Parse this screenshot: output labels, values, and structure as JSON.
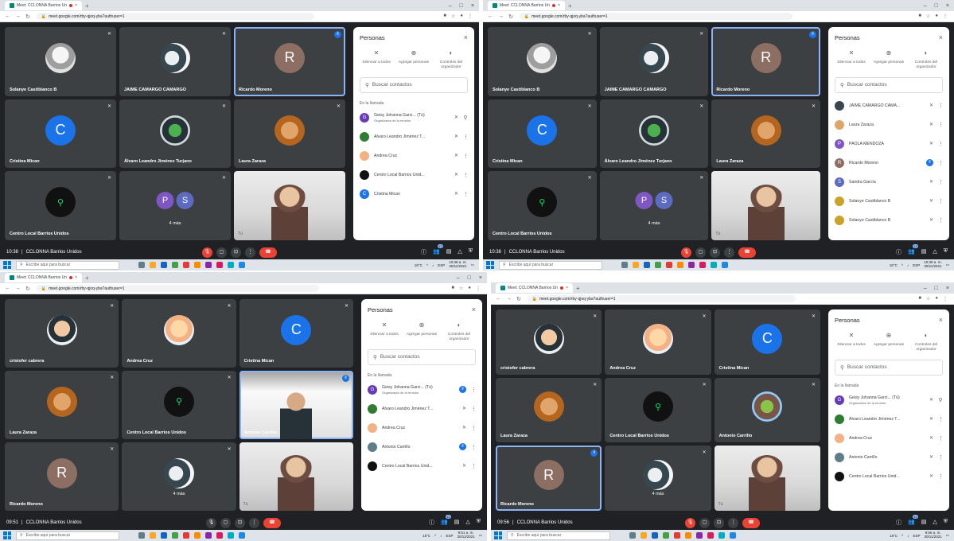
{
  "browser": {
    "tab_title": "Meet: CCLONNA Barrios Un",
    "new_tab": "+",
    "url": "meet.google.com/rby-qjoq-yba?authuser=1"
  },
  "meeting_name": "CCLONNA Barrios Unidos",
  "panel": {
    "title": "Personas",
    "actions": [
      {
        "label": "Silenciar a todos",
        "icon": "mute-all-icon"
      },
      {
        "label": "Agregar personas",
        "icon": "add-person-icon"
      },
      {
        "label": "Controles del organizador",
        "icon": "host-controls-icon"
      }
    ],
    "search_placeholder": "Buscar contactos",
    "section": "En la llamada",
    "organizer_sub": "Organizador de la reunión"
  },
  "taskbar": {
    "search_placeholder": "Escribe aquí para buscar",
    "weather": "18°C",
    "lang": "ESP",
    "date": "30/11/2021"
  },
  "quads": [
    {
      "time": "10:38",
      "clock": "10:38 a. m.",
      "badge": "12",
      "tiles": [
        {
          "name": "Solanye Castiblanco B",
          "avatar": "photo"
        },
        {
          "name": "JAIME CAMARGO CAMARGO",
          "avatar": "pair"
        },
        {
          "name": "Ricardo Moreno",
          "avatar": "R",
          "active": true
        },
        {
          "name": "Cristina Mican",
          "avatar": "C"
        },
        {
          "name": "Álvaro Leandro Jiménez Turjano",
          "avatar": "team"
        },
        {
          "name": "Laura Zaraza",
          "avatar": "cat"
        },
        {
          "name": "Centro Local Barrios Unidos",
          "avatar": "bike"
        },
        {
          "name": "4 más",
          "avatar": "ps"
        },
        {
          "name": "Tú",
          "avatar": "cam"
        }
      ],
      "people": [
        {
          "name": "Geisy Johanna Garci... (Tú)",
          "sub": true,
          "color": "#673ab7",
          "letter": "G",
          "right": "pin"
        },
        {
          "name": "Álvaro Leandro Jiménez T...",
          "color": "#2e7d32",
          "letter": "",
          "right": "dots"
        },
        {
          "name": "Andrea Cruz",
          "color": "#f4b183",
          "letter": "",
          "right": "dots"
        },
        {
          "name": "Centro Local Barrios Unid...",
          "color": "#111111",
          "letter": "",
          "right": "dots"
        },
        {
          "name": "Cristina Mican",
          "color": "#1a73e8",
          "letter": "C",
          "right": "dots"
        }
      ]
    },
    {
      "time": "10:38",
      "clock": "10:38 a. m.",
      "badge": "12",
      "tiles": [
        {
          "name": "Solanye Castiblanco B",
          "avatar": "photo"
        },
        {
          "name": "JAIME CAMARGO CAMARGO",
          "avatar": "pair"
        },
        {
          "name": "Ricardo Moreno",
          "avatar": "R",
          "active": true
        },
        {
          "name": "Cristina Mican",
          "avatar": "C"
        },
        {
          "name": "Álvaro Leandro Jiménez Turjano",
          "avatar": "team"
        },
        {
          "name": "Laura Zaraza",
          "avatar": "cat"
        },
        {
          "name": "Centro Local Barrios Unidos",
          "avatar": "bike"
        },
        {
          "name": "4 más",
          "avatar": "ps"
        },
        {
          "name": "Tú",
          "avatar": "cam"
        }
      ],
      "people": [
        {
          "name": "JAIME CAMARGO CAMA...",
          "color": "#37474f",
          "letter": "",
          "right": "dots"
        },
        {
          "name": "Laura Zaraza",
          "color": "#e0a56b",
          "letter": "",
          "right": "dots"
        },
        {
          "name": "PAOLA MENDOZA",
          "color": "#7e57c2",
          "letter": "P",
          "right": "dots"
        },
        {
          "name": "Ricardo Moreno",
          "color": "#8d6e63",
          "letter": "R",
          "right": "blue"
        },
        {
          "name": "Sandra García",
          "color": "#5c6bc0",
          "letter": "S",
          "right": "dots"
        },
        {
          "name": "Solanye Castiblanco B",
          "color": "#c9a227",
          "letter": "",
          "right": "dots"
        },
        {
          "name": "Solanye Castiblanco B",
          "color": "#c9a227",
          "letter": "",
          "right": "dots"
        }
      ]
    },
    {
      "time": "09:51",
      "clock": "9:51 a. m.",
      "badge": "12",
      "tiles": [
        {
          "name": "cristofer cabrera",
          "avatar": "boy"
        },
        {
          "name": "Andrea Cruz",
          "avatar": "girl"
        },
        {
          "name": "Cristina Mican",
          "avatar": "C"
        },
        {
          "name": "Laura Zaraza",
          "avatar": "cat"
        },
        {
          "name": "Centro Local Barrios Unidos",
          "avatar": "bike"
        },
        {
          "name": "Antonio Carrillo",
          "avatar": "cam2",
          "active": true
        },
        {
          "name": "Ricardo Moreno",
          "avatar": "R"
        },
        {
          "name": "4 más",
          "avatar": "pair"
        },
        {
          "name": "Tú",
          "avatar": "cam"
        }
      ],
      "people": [
        {
          "name": "Geisy Johanna Garci... (Tú)",
          "sub": true,
          "color": "#673ab7",
          "letter": "G",
          "right": "blue"
        },
        {
          "name": "Álvaro Leandro Jiménez T...",
          "color": "#2e7d32",
          "letter": "",
          "right": "dots"
        },
        {
          "name": "Andrea Cruz",
          "color": "#f4b183",
          "letter": "",
          "right": "dots"
        },
        {
          "name": "Antonio Carrillo",
          "color": "#607d8b",
          "letter": "",
          "right": "blue"
        },
        {
          "name": "Centro Local Barrios Unid...",
          "color": "#111111",
          "letter": "",
          "right": "dots"
        }
      ]
    },
    {
      "time": "09:56",
      "clock": "9:56 a. m.",
      "badge": "12",
      "tiles": [
        {
          "name": "cristofer cabrera",
          "avatar": "boy"
        },
        {
          "name": "Andrea Cruz",
          "avatar": "girl"
        },
        {
          "name": "Cristina Mican",
          "avatar": "C"
        },
        {
          "name": "Laura Zaraza",
          "avatar": "cat"
        },
        {
          "name": "Centro Local Barrios Unidos",
          "avatar": "bike"
        },
        {
          "name": "Antonio Carrillo",
          "avatar": "house"
        },
        {
          "name": "Ricardo Moreno",
          "avatar": "R",
          "active": true
        },
        {
          "name": "4 más",
          "avatar": "pair"
        },
        {
          "name": "Tú",
          "avatar": "cam"
        }
      ],
      "people": [
        {
          "name": "Geisy Johanna Garci... (Tú)",
          "sub": true,
          "color": "#673ab7",
          "letter": "G",
          "right": "pin"
        },
        {
          "name": "Álvaro Leandro Jiménez T...",
          "color": "#2e7d32",
          "letter": "",
          "right": "dots"
        },
        {
          "name": "Andrea Cruz",
          "color": "#f4b183",
          "letter": "",
          "right": "dots"
        },
        {
          "name": "Antonio Carrillo",
          "color": "#607d8b",
          "letter": "",
          "right": "dots"
        },
        {
          "name": "Centro Local Barrios Unid...",
          "color": "#111111",
          "letter": "",
          "right": "dots"
        }
      ]
    }
  ]
}
